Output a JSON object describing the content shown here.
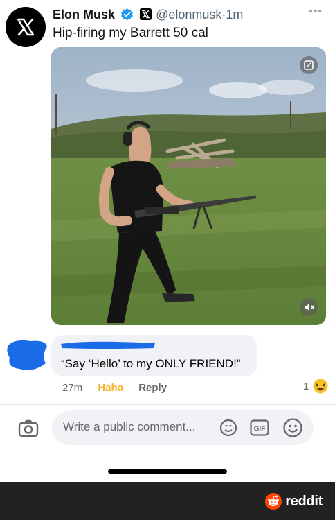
{
  "tweet": {
    "author_name": "Elon Musk",
    "author_handle": "@elonmusk",
    "separator": "·",
    "time": "1m",
    "text": "Hip-firing my Barrett 50 cal",
    "avatar_icon": "x-logo-icon",
    "verified_color": "#1d9bf0"
  },
  "comment": {
    "text": "“Say ‘Hello’ to my ONLY FRIEND!”",
    "time": "27m",
    "haha_label": "Haha",
    "reply_label": "Reply",
    "reaction_count": "1",
    "redaction_color": "#1a6be8"
  },
  "composer": {
    "placeholder": "Write a public comment..."
  },
  "footer": {
    "brand": "reddit",
    "brand_color": "#ff4500"
  }
}
